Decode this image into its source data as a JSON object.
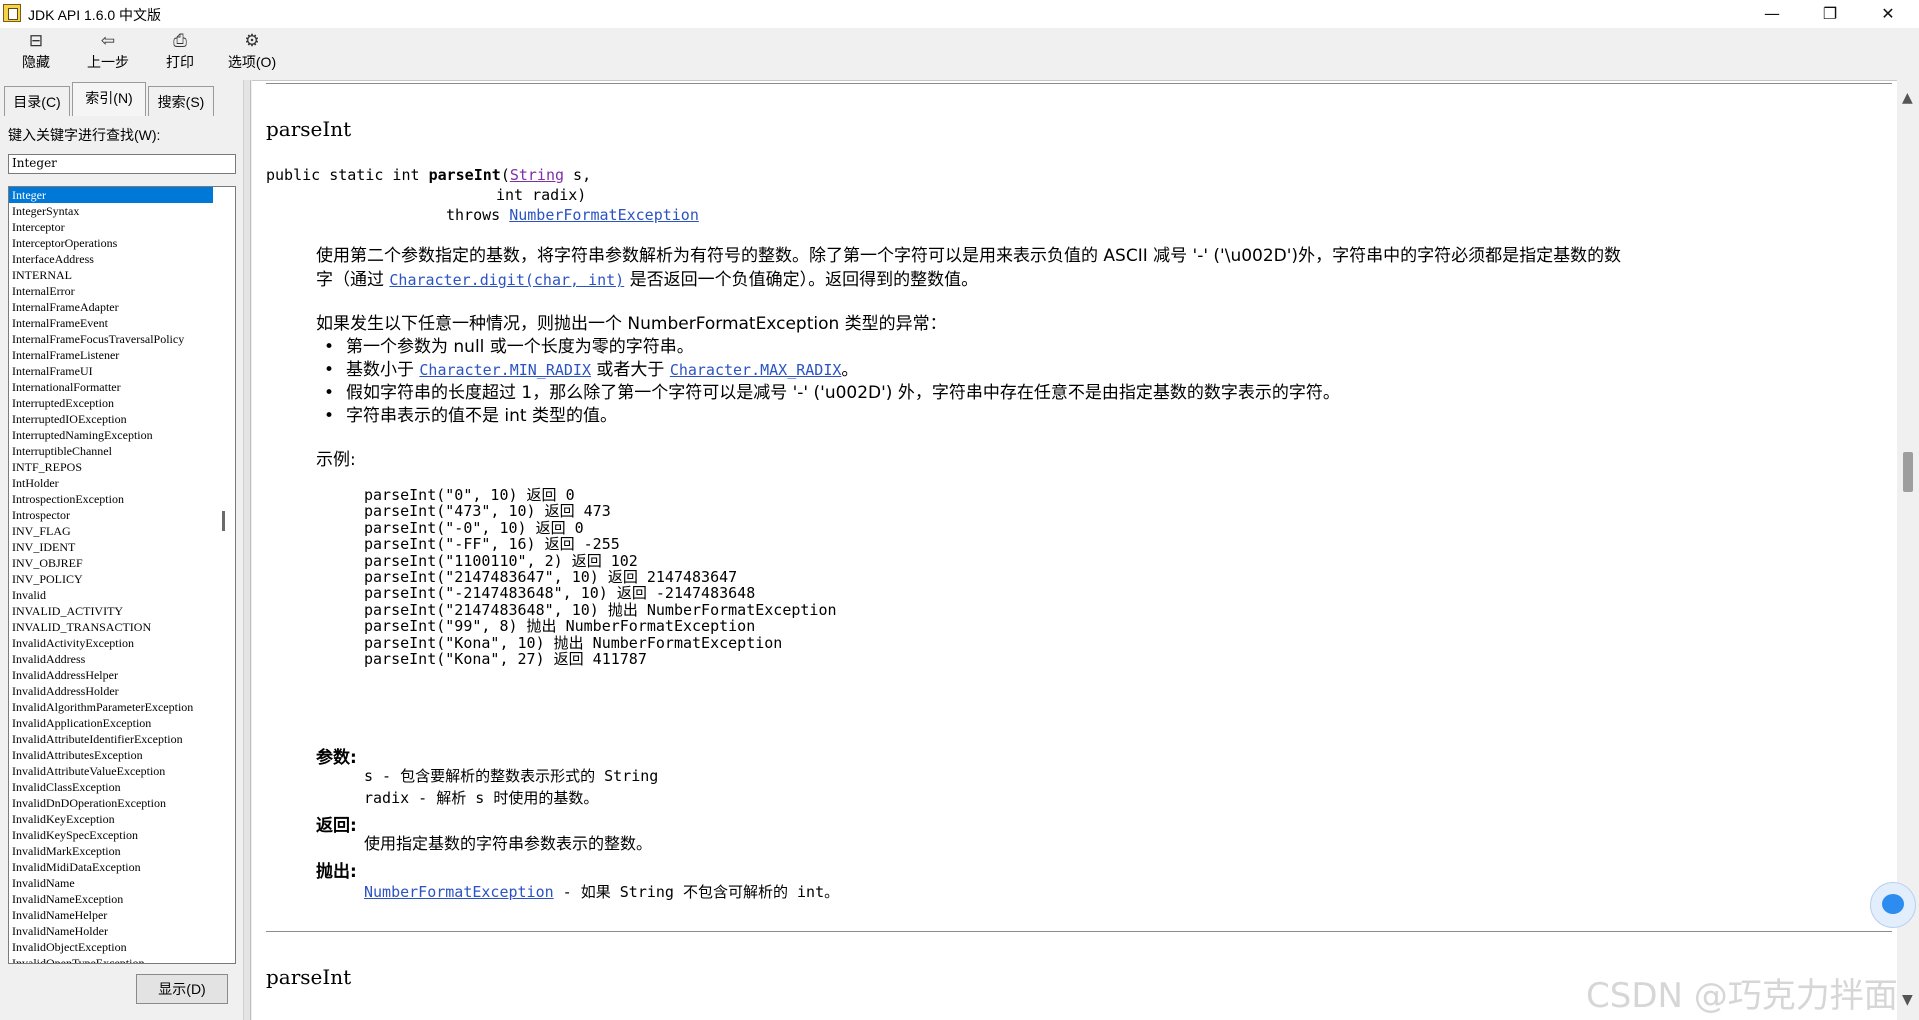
{
  "window": {
    "title": "JDK API 1.6.0 中文版",
    "minimize": "—",
    "restore": "❐",
    "close": "✕"
  },
  "toolbar": [
    {
      "label": "隐藏",
      "icon": "hide-icon",
      "glyph": "⊟"
    },
    {
      "label": "上一步",
      "icon": "back-arrow-icon",
      "glyph": "⇦"
    },
    {
      "label": "打印",
      "icon": "printer-icon",
      "glyph": "⎙"
    },
    {
      "label": "选项(O)",
      "icon": "options-icon",
      "glyph": "⚙"
    }
  ],
  "nav": {
    "tabs": [
      "目录(C)",
      "索引(N)",
      "搜索(S)"
    ],
    "active_tab": "索引(N)",
    "keyword_label": "键入关键字进行查找(W):",
    "keyword_value": "Integer",
    "show_button": "显示(D)",
    "items": [
      "Integer",
      "IntegerSyntax",
      "Interceptor",
      "InterceptorOperations",
      "InterfaceAddress",
      "INTERNAL",
      "InternalError",
      "InternalFrameAdapter",
      "InternalFrameEvent",
      "InternalFrameFocusTraversalPolicy",
      "InternalFrameListener",
      "InternalFrameUI",
      "InternationalFormatter",
      "InterruptedException",
      "InterruptedIOException",
      "InterruptedNamingException",
      "InterruptibleChannel",
      "INTF_REPOS",
      "IntHolder",
      "IntrospectionException",
      "Introspector",
      "INV_FLAG",
      "INV_IDENT",
      "INV_OBJREF",
      "INV_POLICY",
      "Invalid",
      "INVALID_ACTIVITY",
      "INVALID_TRANSACTION",
      "InvalidActivityException",
      "InvalidAddress",
      "InvalidAddressHelper",
      "InvalidAddressHolder",
      "InvalidAlgorithmParameterException",
      "InvalidApplicationException",
      "InvalidAttributeIdentifierException",
      "InvalidAttributesException",
      "InvalidAttributeValueException",
      "InvalidClassException",
      "InvalidDnDOperationException",
      "InvalidKeyException",
      "InvalidKeySpecException",
      "InvalidMarkException",
      "InvalidMidiDataException",
      "InvalidName",
      "InvalidNameException",
      "InvalidNameHelper",
      "InvalidNameHolder",
      "InvalidObjectException",
      "InvalidOpenTypeException"
    ]
  },
  "doc": {
    "method_name": "parseInt",
    "signature": {
      "prefix": "public static int ",
      "name": "parseInt",
      "open": "(",
      "param1_type": "String",
      "param1_rest": " s,",
      "line2": "int radix)",
      "throws_kw": "throws ",
      "throws_type": "NumberFormatException"
    },
    "desc1_a": "使用第二个参数指定的基数，将字符串参数解析为有符号的整数。除了第一个字符可以是用来表示负值的 ASCII 减号 '-' ('\\u002D')外，字符串中的字符必须都是指定基数的数",
    "desc1_b": "字（通过 ",
    "desc1_link": "Character.digit(char, int)",
    "desc1_c": " 是否返回一个负值确定）。返回得到的整数值。",
    "desc2": "如果发生以下任意一种情况，则抛出一个 NumberFormatException 类型的异常：",
    "bullet1": "第一个参数为 null 或一个长度为零的字符串。",
    "bullet2_a": "基数小于 ",
    "bullet2_link1": "Character.MIN_RADIX",
    "bullet2_b": " 或者大于 ",
    "bullet2_link2": "Character.MAX_RADIX",
    "bullet2_c": "。",
    "bullet3": "假如字符串的长度超过 1，那么除了第一个字符可以是减号 '-' ('u002D') 外，字符串中存在任意不是由指定基数的数字表示的字符。",
    "bullet4": "字符串表示的值不是 int 类型的值。",
    "examples_label": "示例:",
    "examples": [
      "parseInt(\"0\", 10) 返回 0",
      "parseInt(\"473\", 10) 返回 473",
      "parseInt(\"-0\", 10) 返回 0",
      "parseInt(\"-FF\", 16) 返回 -255",
      "parseInt(\"1100110\", 2) 返回 102",
      "parseInt(\"2147483647\", 10) 返回 2147483647",
      "parseInt(\"-2147483648\", 10) 返回 -2147483648",
      "parseInt(\"2147483648\", 10) 抛出 NumberFormatException",
      "parseInt(\"99\", 8) 抛出 NumberFormatException",
      "parseInt(\"Kona\", 10) 抛出 NumberFormatException",
      "parseInt(\"Kona\", 27) 返回 411787"
    ],
    "params_label": "参数:",
    "param_s": "s - 包含要解析的整数表示形式的 String",
    "param_radix": "radix - 解析 s 时使用的基数。",
    "returns_label": "返回:",
    "returns": "使用指定基数的字符串参数表示的整数。",
    "throws_label": "抛出:",
    "throws_link": "NumberFormatException",
    "throws_desc": " - 如果 String 不包含可解析的 int。",
    "next_method_name": "parseInt"
  },
  "scroll": {
    "up": "▲",
    "down": "▼"
  },
  "watermark": "CSDN @巧克力拌面"
}
